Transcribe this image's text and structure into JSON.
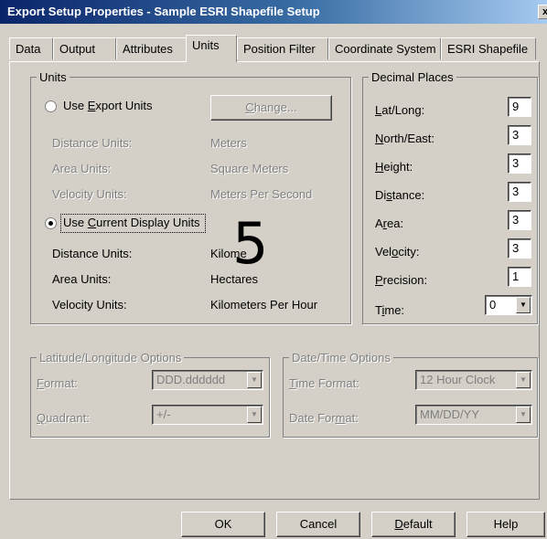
{
  "window": {
    "title": "Export Setup Properties - Sample ESRI Shapefile Setup",
    "close_glyph": "x"
  },
  "tabs": [
    {
      "label": "Data"
    },
    {
      "label": "Output"
    },
    {
      "label": "Attributes"
    },
    {
      "label": "Units",
      "active": true
    },
    {
      "label": "Position Filter"
    },
    {
      "label": "Coordinate System"
    },
    {
      "label": "ESRI Shapefile"
    }
  ],
  "units": {
    "legend": "Units",
    "export_radio": {
      "pre": "Use ",
      "mnemonic": "E",
      "post": "xport Units",
      "selected": false
    },
    "change_button": {
      "pre": "",
      "mnemonic": "C",
      "post": "hange..."
    },
    "export_rows": [
      {
        "label": "Distance Units:",
        "value": "Meters"
      },
      {
        "label": "Area Units:",
        "value": "Square Meters"
      },
      {
        "label": "Velocity Units:",
        "value": "Meters Per Second"
      }
    ],
    "current_radio": {
      "pre": "Use ",
      "mnemonic": "C",
      "post": "urrent Display Units",
      "selected": true
    },
    "current_rows": [
      {
        "label": "Distance Units:",
        "value": "Kilome"
      },
      {
        "label": "Area Units:",
        "value": "Hectares"
      },
      {
        "label": "Velocity Units:",
        "value": "Kilometers Per Hour"
      }
    ]
  },
  "decimal_places": {
    "legend": "Decimal Places",
    "rows": [
      {
        "pre": "",
        "mnemonic": "L",
        "post": "at/Long:",
        "value": "9"
      },
      {
        "pre": "",
        "mnemonic": "N",
        "post": "orth/East:",
        "value": "3"
      },
      {
        "pre": "",
        "mnemonic": "H",
        "post": "eight:",
        "value": "3"
      },
      {
        "pre": "Di",
        "mnemonic": "s",
        "post": "tance:",
        "value": "3"
      },
      {
        "pre": "A",
        "mnemonic": "r",
        "post": "ea:",
        "value": "3"
      },
      {
        "pre": "Vel",
        "mnemonic": "o",
        "post": "city:",
        "value": "3"
      },
      {
        "pre": "",
        "mnemonic": "P",
        "post": "recision:",
        "value": "1"
      }
    ],
    "time": {
      "pre": "T",
      "mnemonic": "i",
      "post": "me:",
      "value": "0"
    }
  },
  "latlong_options": {
    "legend": "Latitude/Longitude Options",
    "format": {
      "pre": "",
      "mnemonic": "F",
      "post": "ormat:",
      "value": "DDD.dddddd"
    },
    "quadrant": {
      "pre": "",
      "mnemonic": "Q",
      "post": "uadrant:",
      "value": "+/-"
    }
  },
  "datetime_options": {
    "legend": "Date/Time Options",
    "time_format": {
      "pre": "",
      "mnemonic": "T",
      "post": "ime Format:",
      "value": "12 Hour Clock"
    },
    "date_format": {
      "pre": "Date For",
      "mnemonic": "m",
      "post": "at:",
      "value": "MM/DD/YY"
    }
  },
  "buttons": {
    "ok": "OK",
    "cancel": "Cancel",
    "default": {
      "pre": "",
      "mnemonic": "D",
      "post": "efault"
    },
    "help": "Help"
  },
  "overlay_label": "5"
}
